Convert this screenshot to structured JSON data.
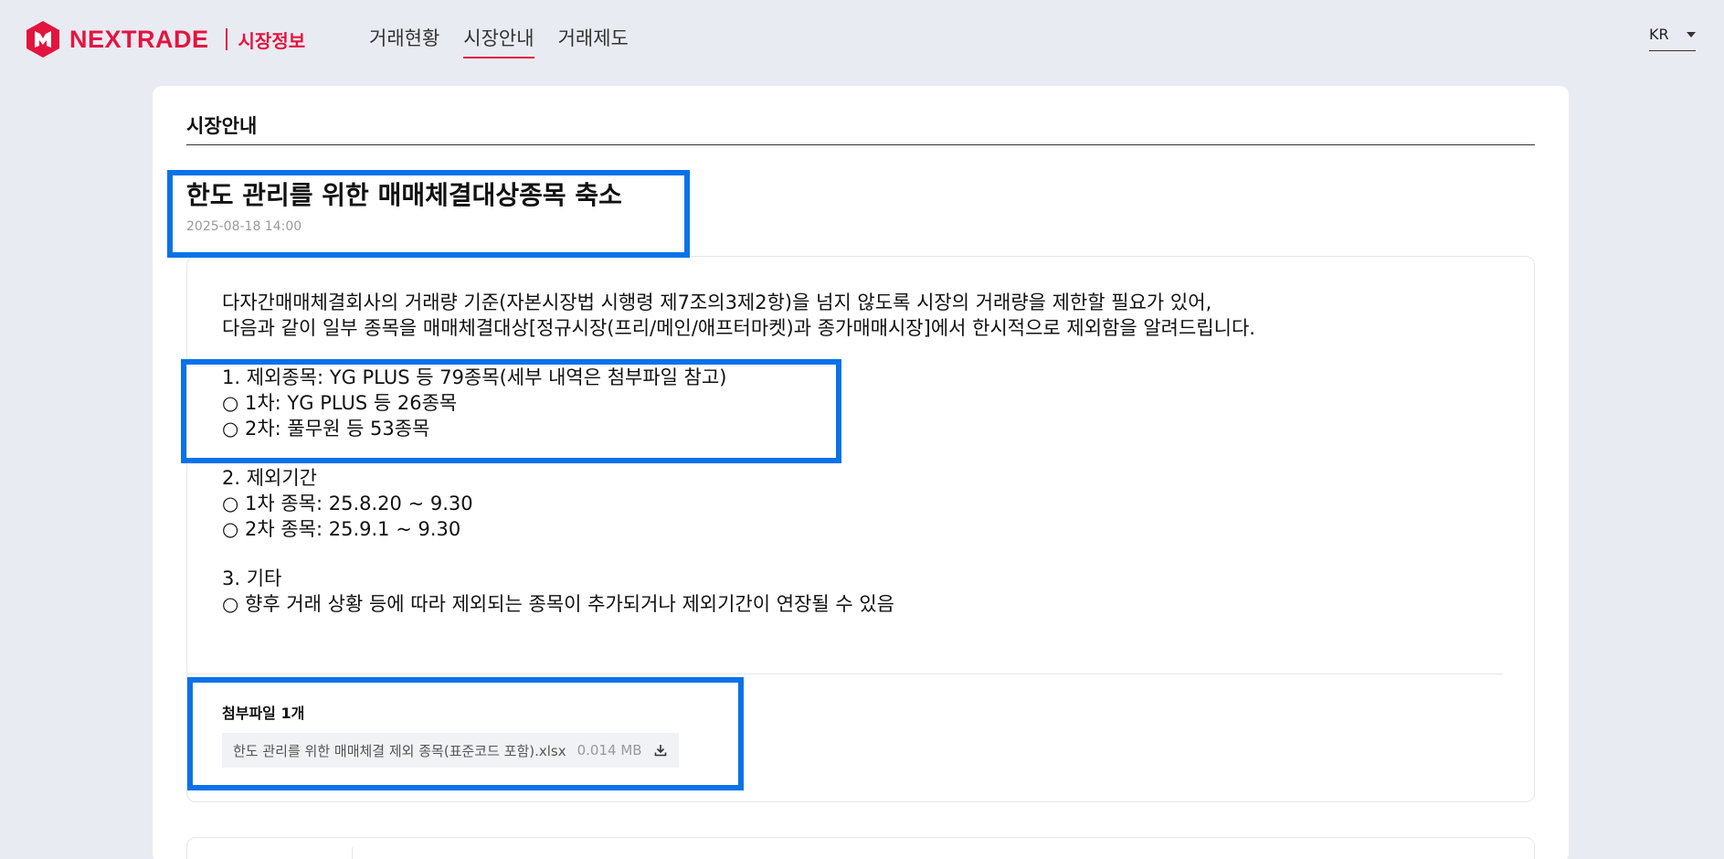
{
  "header": {
    "logo_word": "NEXTRADE",
    "logo_sub": "시장정보",
    "nav": [
      {
        "label": "거래현황",
        "active": false
      },
      {
        "label": "시장안내",
        "active": true
      },
      {
        "label": "거래제도",
        "active": false
      }
    ],
    "lang": "KR"
  },
  "section": {
    "title": "시장안내"
  },
  "article": {
    "title": "한도 관리를 위한 매매체결대상종목 축소",
    "date": "2025-08-18 14:00",
    "body": {
      "intro1": "다자간매매체결회사의 거래량 기준(자본시장법 시행령 제7조의3제2항)을 넘지 않도록 시장의 거래량을 제한할 필요가 있어,",
      "intro2": "다음과 같이 일부 종목을 매매체결대상[정규시장(프리/메인/애프터마켓)과 종가매매시장]에서 한시적으로 제외함을 알려드립니다.",
      "item1": "1. 제외종목: YG PLUS 등 79종목(세부 내역은 첨부파일 참고)",
      "item1_a": "○ 1차: YG PLUS 등 26종목",
      "item1_b": "○ 2차: 풀무원 등 53종목",
      "item2": "2. 제외기간",
      "item2_a": "○ 1차 종목: 25.8.20 ~ 9.30",
      "item2_b": "○ 2차 종목: 25.9.1 ~ 9.30",
      "item3": "3. 기타",
      "item3_a": "○ 향후 거래 상황 등에 따라 제외되는 종목이 추가되거나 제외기간이 연장될 수 있음"
    },
    "attachments": {
      "title": "첨부파일 1개",
      "file_name": "한도 관리를 위한 매매체결 제외 종목(표준코드 포함).xlsx",
      "file_size": "0.014 MB",
      "icon": "download-icon"
    }
  },
  "colors": {
    "brand": "#e3153f",
    "highlight": "#0a72e8",
    "background": "#e9ebf2"
  }
}
